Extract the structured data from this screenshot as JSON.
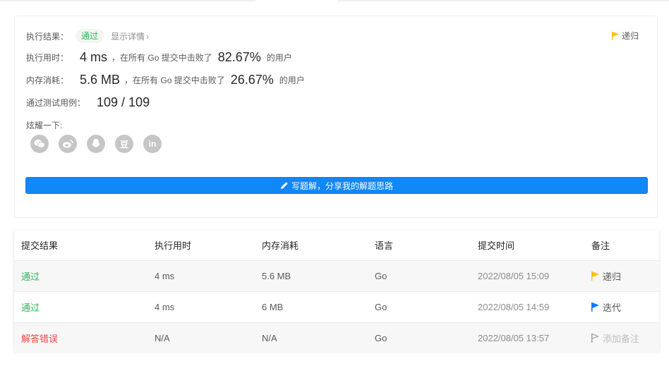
{
  "result": {
    "status_label": "执行结果：",
    "status_value": "通过",
    "details_link": "显示详情",
    "details_chevron": "›",
    "note": "递归",
    "runtime": {
      "label": "执行用时：",
      "value": "4 ms",
      "beat_prefix": "，在所有 Go 提交中击败了",
      "beat_value": "82.67%",
      "beat_suffix": "的用户"
    },
    "memory": {
      "label": "内存消耗：",
      "value": "5.6 MB",
      "beat_prefix": "，在所有 Go 提交中击败了",
      "beat_value": "26.67%",
      "beat_suffix": "的用户"
    },
    "tests": {
      "label": "通过测试用例：",
      "value": "109 / 109"
    },
    "share_label": "炫耀一下:",
    "share_icons": [
      "wechat-icon",
      "weibo-icon",
      "qq-icon",
      "douban-icon",
      "linkedin-icon"
    ],
    "share_glyphs": {
      "douban": "豆",
      "linkedin": "in"
    },
    "write_button": "写题解，分享我的解题思路"
  },
  "submissions": {
    "headers": [
      "提交结果",
      "执行用时",
      "内存消耗",
      "语言",
      "提交时间",
      "备注"
    ],
    "rows": [
      {
        "status": "通过",
        "runtime": "4 ms",
        "memory": "5.6 MB",
        "lang": "Go",
        "time": "2022/08/05 15:09",
        "note": "递归"
      },
      {
        "status": "通过",
        "runtime": "4 ms",
        "memory": "6 MB",
        "lang": "Go",
        "time": "2022/08/05 14:59",
        "note": "迭代"
      },
      {
        "status": "解答错误",
        "runtime": "N/A",
        "memory": "N/A",
        "lang": "Go",
        "time": "2022/08/05 13:57",
        "note": "添加备注"
      }
    ]
  },
  "colors": {
    "accent": "#1287f6",
    "pass": "#2db55d",
    "fail": "#ef4743",
    "flag_yellow": "#ffc01e",
    "flag_blue": "#007aff"
  }
}
